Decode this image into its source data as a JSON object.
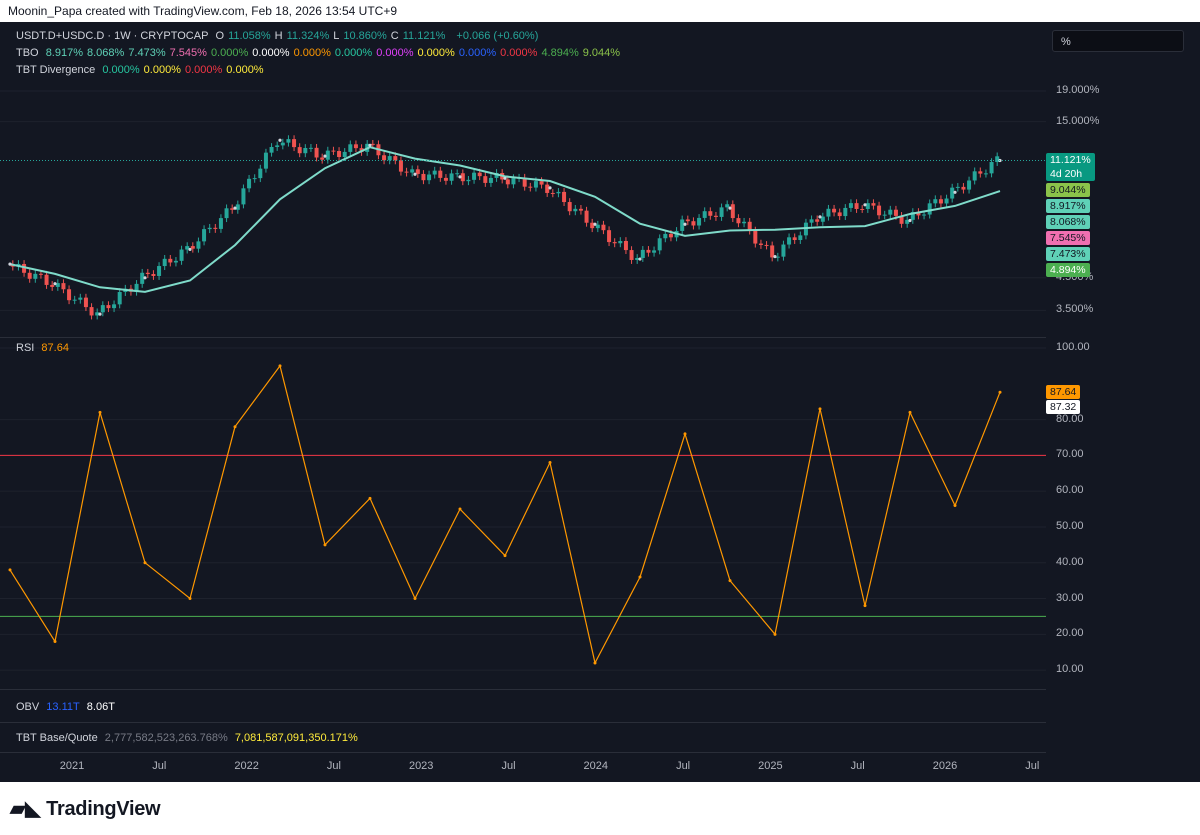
{
  "header": {
    "attribution": "Moonin_Papa created with TradingView.com, Feb 18, 2026 13:54 UTC+9"
  },
  "legend": {
    "symbol": "USDT.D+USDC.D · 1W · CRYPTOCAP",
    "ohlc": [
      {
        "k": "O",
        "v": "11.058%"
      },
      {
        "k": "H",
        "v": "11.324%"
      },
      {
        "k": "L",
        "v": "10.860%"
      },
      {
        "k": "C",
        "v": "11.121%"
      }
    ],
    "change": "+0.066 (+0.60%)",
    "tbo_label": "TBO",
    "tbo_values": [
      {
        "v": "8.917%",
        "color": "#5fd1b7"
      },
      {
        "v": "8.068%",
        "color": "#5fd1b7"
      },
      {
        "v": "7.473%",
        "color": "#5fd1b7"
      },
      {
        "v": "7.545%",
        "color": "#f06fb0"
      },
      {
        "v": "0.000%",
        "color": "#4caf50"
      },
      {
        "v": "0.000%",
        "color": "#ffffff"
      },
      {
        "v": "0.000%",
        "color": "#ff9800"
      },
      {
        "v": "0.000%",
        "color": "#26c6a0"
      },
      {
        "v": "0.000%",
        "color": "#e040fb"
      },
      {
        "v": "0.000%",
        "color": "#ffeb3b"
      },
      {
        "v": "0.000%",
        "color": "#2962ff"
      },
      {
        "v": "0.000%",
        "color": "#f23645"
      },
      {
        "v": "4.894%",
        "color": "#4caf50"
      },
      {
        "v": "9.044%",
        "color": "#8bc34a"
      }
    ],
    "tbt_label": "TBT Divergence",
    "tbt_values": [
      {
        "v": "0.000%",
        "color": "#26c6a0"
      },
      {
        "v": "0.000%",
        "color": "#ffeb3b"
      },
      {
        "v": "0.000%",
        "color": "#f23645"
      },
      {
        "v": "0.000%",
        "color": "#ffeb3b"
      }
    ],
    "scale_box": "%"
  },
  "price_axis": {
    "ticks": [
      {
        "label": "19.000%",
        "value": 19
      },
      {
        "label": "15.000%",
        "value": 15
      },
      {
        "label": "4.500%",
        "value": 4.5
      },
      {
        "label": "3.500%",
        "value": 3.5
      }
    ],
    "badges": [
      {
        "label": "11.121%",
        "sub": "4d 20h",
        "value": 11.121,
        "bg": "#089981",
        "fg": "#ffffff"
      },
      {
        "label": "9.044%",
        "value": 9.044,
        "bg": "#8bc34a",
        "fg": "#131722"
      },
      {
        "label": "8.917%",
        "value": 8.917,
        "bg": "#5fd1b7",
        "fg": "#131722"
      },
      {
        "label": "8.068%",
        "value": 8.068,
        "bg": "#5fd1b7",
        "fg": "#131722"
      },
      {
        "label": "7.545%",
        "value": 7.545,
        "bg": "#f06fb0",
        "fg": "#131722"
      },
      {
        "label": "7.473%",
        "value": 7.473,
        "bg": "#5fd1b7",
        "fg": "#131722"
      },
      {
        "label": "4.894%",
        "value": 4.894,
        "bg": "#4caf50",
        "fg": "#ffffff"
      }
    ]
  },
  "rsi": {
    "label": "RSI",
    "value": "87.64",
    "axis_ticks": [
      "100.00",
      "80.00",
      "70.00",
      "60.00",
      "50.00",
      "40.00",
      "30.00",
      "20.00",
      "10.00"
    ],
    "badges": [
      {
        "label": "87.64",
        "value": 87.64,
        "bg": "#ff9800",
        "fg": "#131722"
      },
      {
        "label": "87.32",
        "value": 87.32,
        "bg": "#ffffff",
        "fg": "#131722"
      }
    ],
    "levels": {
      "overbought": 70,
      "oversold": 25
    }
  },
  "obv": {
    "label": "OBV",
    "v1": "13.11T",
    "v2": "8.06T"
  },
  "tbt_base": {
    "label": "TBT Base/Quote",
    "v1": "2,777,582,523,263.768%",
    "v2": "7,081,587,091,350.171%"
  },
  "time_axis": [
    "2021",
    "Jul",
    "2022",
    "Jul",
    "2023",
    "Jul",
    "2024",
    "Jul",
    "2025",
    "Jul",
    "2026",
    "Jul"
  ],
  "footer": {
    "brand": "TradingView"
  },
  "colors": {
    "bg": "#131722",
    "up": "#26a69a",
    "down": "#ef5350",
    "rsi": "#ff9800",
    "ma_up": "#7fdbca",
    "ma_down": "#f48fb1"
  },
  "chart_data": [
    {
      "type": "line",
      "title": "USDT.D+USDC.D · 1W · CRYPTOCAP",
      "ylabel": "%",
      "scale": "log",
      "x": [
        "2021-01",
        "2021-04",
        "2021-07",
        "2021-10",
        "2022-01",
        "2022-04",
        "2022-06",
        "2022-09",
        "2022-12",
        "2023-03",
        "2023-06",
        "2023-09",
        "2023-12",
        "2024-02",
        "2024-04",
        "2024-07",
        "2024-10",
        "2025-01",
        "2025-04",
        "2025-07",
        "2025-10",
        "2026-01",
        "2026-02"
      ],
      "series": [
        {
          "name": "USDT.D+USDC.D",
          "values": [
            5.0,
            4.3,
            3.4,
            4.5,
            5.6,
            7.7,
            13.0,
            11.5,
            12.5,
            10.0,
            9.8,
            9.7,
            9.0,
            6.8,
            5.2,
            6.8,
            7.7,
            5.3,
            7.2,
            7.9,
            7.0,
            8.7,
            11.121
          ]
        }
      ],
      "ylim": [
        3.2,
        22
      ]
    },
    {
      "type": "line",
      "title": "RSI",
      "x": [
        "2021-01",
        "2021-04",
        "2021-07",
        "2021-10",
        "2022-01",
        "2022-04",
        "2022-06",
        "2022-09",
        "2022-12",
        "2023-03",
        "2023-06",
        "2023-09",
        "2023-12",
        "2024-02",
        "2024-04",
        "2024-07",
        "2024-10",
        "2025-01",
        "2025-04",
        "2025-07",
        "2025-10",
        "2026-01",
        "2026-02"
      ],
      "series": [
        {
          "name": "RSI",
          "values": [
            38,
            18,
            82,
            40,
            30,
            78,
            95,
            45,
            58,
            30,
            55,
            42,
            68,
            12,
            36,
            76,
            35,
            20,
            83,
            28,
            82,
            56,
            87.64
          ]
        }
      ],
      "levels": [
        70,
        25
      ],
      "ylim": [
        5,
        100
      ]
    }
  ]
}
